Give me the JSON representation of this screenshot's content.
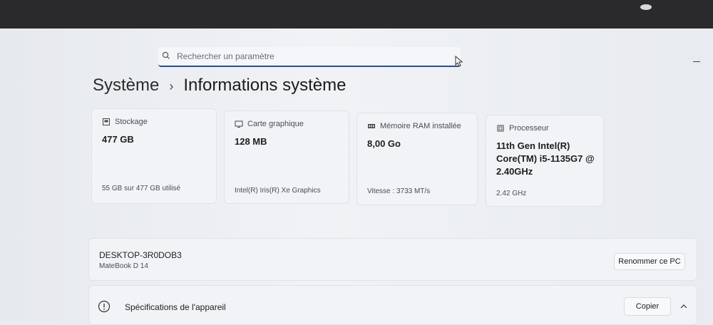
{
  "search": {
    "placeholder": "Rechercher un paramètre"
  },
  "breadcrumb": {
    "parent": "Système",
    "separator": "›",
    "current": "Informations système"
  },
  "cards": [
    {
      "icon": "storage-icon",
      "label": "Stockage",
      "value": "477 GB",
      "footer": "55 GB sur 477 GB utilisé"
    },
    {
      "icon": "graphics-card-icon",
      "label": "Carte graphique",
      "value": "128 MB",
      "footer": "Intel(R) Iris(R) Xe Graphics"
    },
    {
      "icon": "ram-icon",
      "label": "Mémoire RAM installée",
      "value": "8,00 Go",
      "footer": "Vitesse : 3733 MT/s"
    },
    {
      "icon": "processor-icon",
      "label": "Processeur",
      "value": "11th Gen Intel(R) Core(TM) i5-1135G7 @ 2.40GHz",
      "footer": "2.42 GHz"
    }
  ],
  "device": {
    "name": "DESKTOP-3R0DOB3",
    "model": "MateBook D 14",
    "rename_label": "Renommer ce PC"
  },
  "specs": {
    "label": "Spécifications de l'appareil",
    "copy_label": "Copier"
  }
}
